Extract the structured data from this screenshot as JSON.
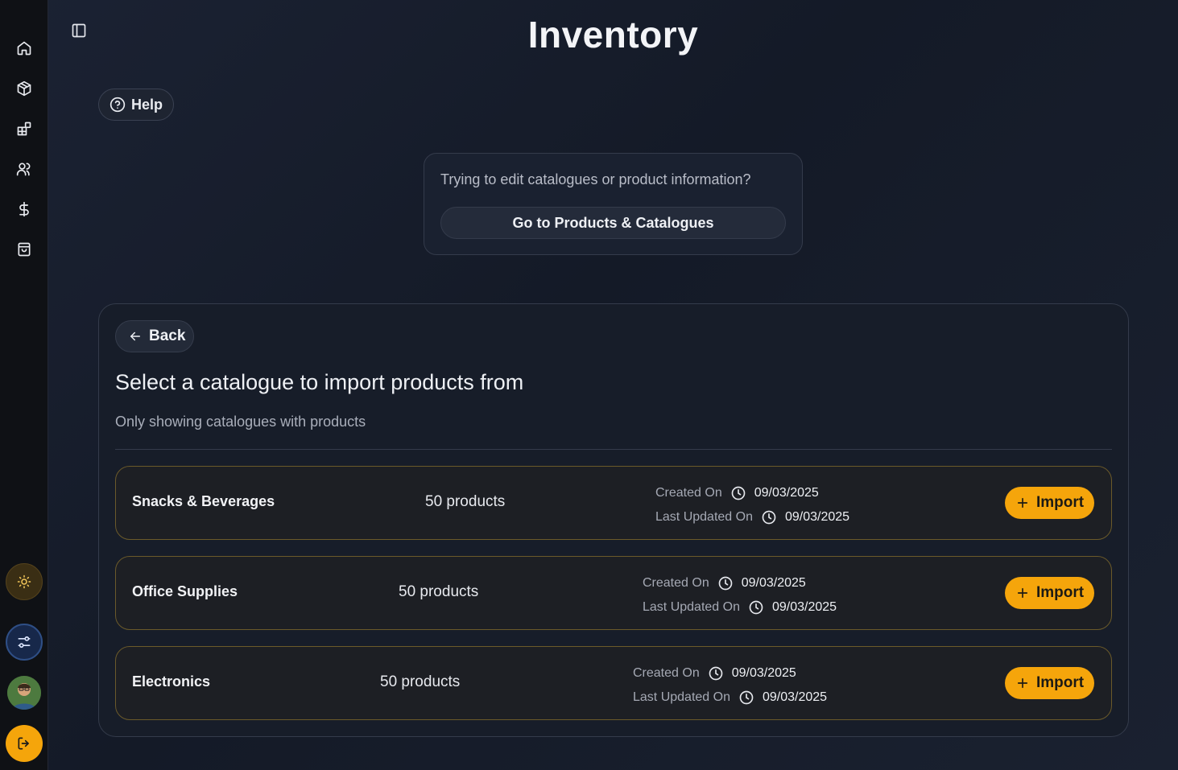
{
  "header": {
    "title": "Inventory",
    "help_label": "Help"
  },
  "sidebar": {
    "items": [
      {
        "icon": "home-icon"
      },
      {
        "icon": "package-icon"
      },
      {
        "icon": "blocks-icon"
      },
      {
        "icon": "users-icon"
      },
      {
        "icon": "dollar-icon"
      },
      {
        "icon": "shopping-bag-icon"
      }
    ]
  },
  "notice": {
    "text": "Trying to edit catalogues or product information?",
    "button_label": "Go to Products & Catalogues"
  },
  "import_panel": {
    "back_label": "Back",
    "heading": "Select a catalogue to import products from",
    "subheading": "Only showing catalogues with products",
    "created_label": "Created On",
    "updated_label": "Last Updated On",
    "import_label": "Import",
    "catalogues": [
      {
        "name": "Snacks & Beverages",
        "count": "50 products",
        "created": "09/03/2025",
        "updated": "09/03/2025"
      },
      {
        "name": "Office Supplies",
        "count": "50 products",
        "created": "09/03/2025",
        "updated": "09/03/2025"
      },
      {
        "name": "Electronics",
        "count": "50 products",
        "created": "09/03/2025",
        "updated": "09/03/2025"
      }
    ]
  },
  "colors": {
    "accent": "#f5a50b",
    "background": "#171d29",
    "sidebar": "#0f1115"
  }
}
